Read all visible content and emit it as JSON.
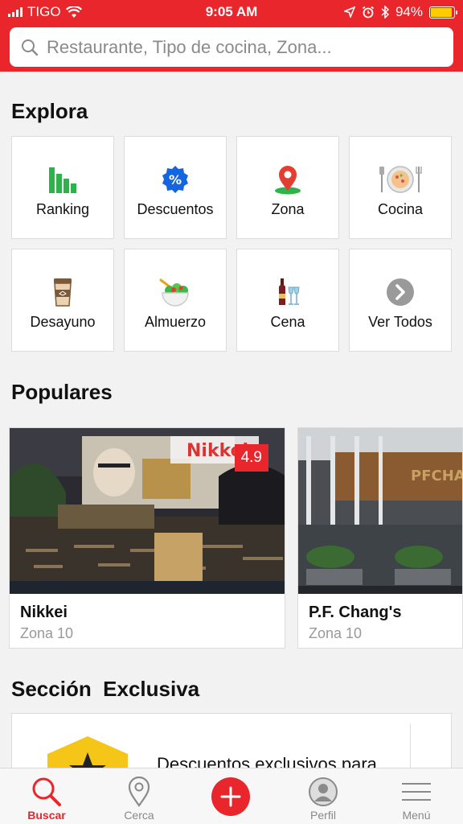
{
  "status_bar": {
    "carrier": "TIGO",
    "time": "9:05 AM",
    "battery": "94%",
    "battery_level": 0.94
  },
  "search": {
    "placeholder": "Restaurante, Tipo de cocina, Zona..."
  },
  "explora": {
    "title": "Explora",
    "items": [
      {
        "label": "Ranking",
        "icon": "bar-chart-icon"
      },
      {
        "label": "Descuentos",
        "icon": "percent-badge-icon"
      },
      {
        "label": "Zona",
        "icon": "map-pin-icon"
      },
      {
        "label": "Cocina",
        "icon": "plate-cutlery-icon"
      },
      {
        "label": "Desayuno",
        "icon": "coffee-cup-icon"
      },
      {
        "label": "Almuerzo",
        "icon": "salad-bowl-icon"
      },
      {
        "label": "Cena",
        "icon": "wine-glasses-icon"
      },
      {
        "label": "Ver Todos",
        "icon": "chevron-right-icon"
      }
    ]
  },
  "populares": {
    "title": "Populares",
    "cards": [
      {
        "name": "Nikkei",
        "zone": "Zona 10",
        "rating": "4.9",
        "sign_text": "Nikkei"
      },
      {
        "name": "P.F. Chang's",
        "zone": "Zona 10",
        "sign_text": "PFCHA"
      }
    ]
  },
  "exclusiva": {
    "title": "Sección  Exclusiva",
    "text": "Descuentos exclusivos para"
  },
  "tabbar": {
    "items": [
      {
        "label": "Buscar",
        "icon": "search-icon",
        "active": true
      },
      {
        "label": "Cerca",
        "icon": "location-pin-icon",
        "active": false
      },
      {
        "label": "",
        "icon": "add-icon",
        "active": false
      },
      {
        "label": "Perfil",
        "icon": "user-icon",
        "active": false
      },
      {
        "label": "Menú",
        "icon": "menu-icon",
        "active": false
      }
    ]
  },
  "colors": {
    "brand_red": "#e8262b",
    "rating_bg": "#e8262b",
    "battery_fill": "#ffcc00"
  }
}
